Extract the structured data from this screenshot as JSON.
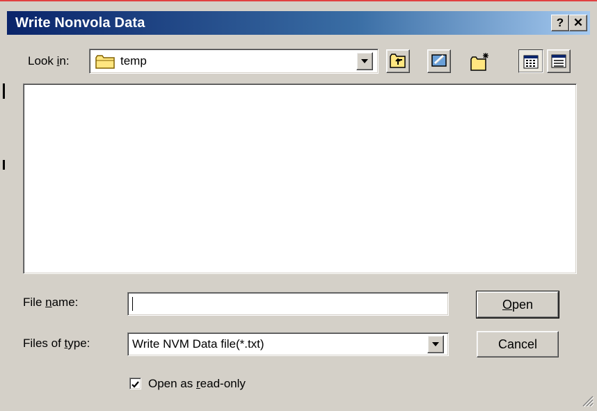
{
  "dialog": {
    "title": "Write Nonvola Data",
    "help_label": "?",
    "close_label": "✕"
  },
  "look_in": {
    "label_pre": "Look ",
    "label_key": "i",
    "label_post": "n:",
    "value": "temp"
  },
  "file_name": {
    "label_pre": "File ",
    "label_key": "n",
    "label_post": "ame:",
    "value": ""
  },
  "files_of_type": {
    "label_pre": "Files of ",
    "label_key": "t",
    "label_post": "ype:",
    "value": "Write NVM Data file(*.txt)"
  },
  "buttons": {
    "open_key": "O",
    "open_rest": "pen",
    "cancel": "Cancel"
  },
  "readonly": {
    "label_pre": "Open as ",
    "label_key": "r",
    "label_post": "ead-only",
    "checked": true
  },
  "colors": {
    "title_bar_start": "#0a246a",
    "title_bar_end": "#a6caf0",
    "face": "#d4d0c8"
  },
  "icons": [
    "folder-icon",
    "up-one-level-icon",
    "desktop-icon",
    "new-folder-icon",
    "list-view-icon",
    "details-view-icon",
    "checkmark-icon",
    "resize-grip-icon"
  ]
}
